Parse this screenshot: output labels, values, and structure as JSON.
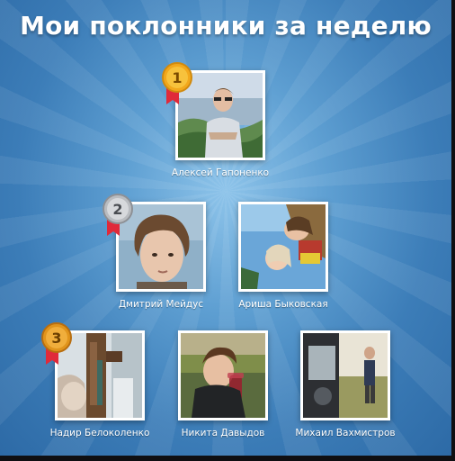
{
  "title": "Мои поклонники за неделю",
  "colors": {
    "gold": "#f2a81c",
    "silver": "#b9bcc0",
    "bronze": "#e0941c",
    "ribbon": "#e02a3a"
  },
  "fans": [
    {
      "name": "Алексей Гапоненко",
      "rank": "1",
      "medal": "gold-medal-icon"
    },
    {
      "name": "Дмитрий Мейдус",
      "rank": "2",
      "medal": "silver-medal-icon"
    },
    {
      "name": "Ариша Быковская"
    },
    {
      "name": "Надир Белоколенко",
      "rank": "3",
      "medal": "bronze-medal-icon"
    },
    {
      "name": "Никита Давыдов"
    },
    {
      "name": "Михаил Вахмистров"
    }
  ]
}
